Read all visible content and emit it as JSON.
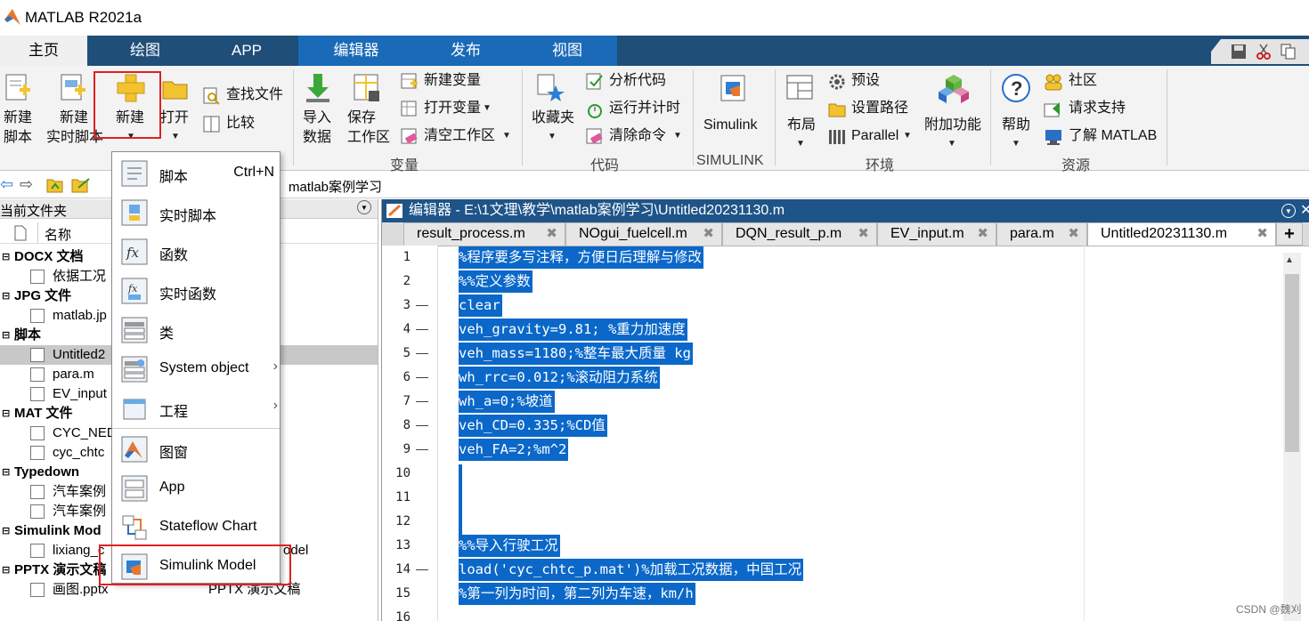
{
  "app": {
    "title": "MATLAB R2021a"
  },
  "main_tabs": [
    "主页",
    "绘图",
    "APP",
    "编辑器",
    "发布",
    "视图"
  ],
  "ribbon": {
    "file": {
      "new_script": [
        "新建",
        "脚本"
      ],
      "new_live": [
        "新建",
        "实时脚本"
      ],
      "new": "新建",
      "open": "打开",
      "find_files": "查找文件",
      "compare": "比较"
    },
    "variable": {
      "import": [
        "导入",
        "数据"
      ],
      "save": [
        "保存",
        "工作区"
      ],
      "new_var": "新建变量",
      "open_var": "打开变量",
      "clear_ws": "清空工作区",
      "label": "变量"
    },
    "code": {
      "favorites": "收藏夹",
      "analyze": "分析代码",
      "run_time": "运行并计时",
      "clear_cmd": "清除命令",
      "label": "代码"
    },
    "simulink": {
      "btn": "Simulink",
      "label": "SIMULINK"
    },
    "environment": {
      "layout": "布局",
      "prefs": "预设",
      "set_path": "设置路径",
      "parallel": "Parallel",
      "addons": "附加功能",
      "label": "环境"
    },
    "resources": {
      "help": "帮助",
      "community": "社区",
      "support": "请求支持",
      "learn": "了解 MATLAB",
      "label": "资源"
    }
  },
  "address": {
    "path": "matlab案例学习"
  },
  "file_panel": {
    "title": "当前文件夹",
    "name_col": "名称",
    "rows": [
      {
        "text": "DOCX 文档",
        "type": "group"
      },
      {
        "text": "依据工况",
        "type": "file"
      },
      {
        "text": "JPG 文件",
        "type": "group"
      },
      {
        "text": "matlab.jp",
        "type": "file"
      },
      {
        "text": "脚本",
        "type": "group"
      },
      {
        "text": "Untitled2",
        "type": "file"
      },
      {
        "text": "para.m",
        "type": "file"
      },
      {
        "text": "EV_input",
        "type": "file"
      },
      {
        "text": "MAT 文件",
        "type": "group"
      },
      {
        "text": "CYC_NED",
        "type": "file"
      },
      {
        "text": "cyc_chtc",
        "type": "file"
      },
      {
        "text": "Typedown",
        "type": "group"
      },
      {
        "text": "汽车案例",
        "type": "file"
      },
      {
        "text": "汽车案例",
        "type": "file"
      },
      {
        "text": "Simulink Mod",
        "type": "group"
      },
      {
        "text": "lixiang_c",
        "type": "file",
        "extra": "odel"
      },
      {
        "text": "PPTX 演示文稿",
        "type": "group"
      },
      {
        "text": "画图.pptx",
        "type": "file",
        "extra": "PPTX 演示文稿"
      }
    ]
  },
  "new_menu": [
    {
      "label": "脚本",
      "shortcut": "Ctrl+N",
      "icon": "script-icon"
    },
    {
      "label": "实时脚本",
      "icon": "live-script-icon"
    },
    {
      "label": "函数",
      "icon": "function-icon"
    },
    {
      "label": "实时函数",
      "icon": "live-function-icon"
    },
    {
      "label": "类",
      "icon": "class-icon"
    },
    {
      "label": "System object",
      "icon": "system-object-icon",
      "submenu": true
    },
    {
      "label": "工程",
      "icon": "project-icon",
      "submenu": true
    },
    {
      "label": "图窗",
      "icon": "figure-icon"
    },
    {
      "label": "App",
      "icon": "app-icon"
    },
    {
      "label": "Stateflow Chart",
      "icon": "stateflow-icon"
    },
    {
      "label": "Simulink Model",
      "icon": "simulink-model-icon"
    }
  ],
  "editor": {
    "title": "编辑器 - E:\\1文理\\教学\\matlab案例学习\\Untitled20231130.m",
    "tabs": [
      "result_process.m",
      "NOgui_fuelcell.m",
      "DQN_result_p.m",
      "EV_input.m",
      "para.m",
      "Untitled20231130.m"
    ],
    "active_tab": 5,
    "lines": [
      {
        "n": "1",
        "dash": "",
        "code": "%程序要多写注释，方便日后理解与修改"
      },
      {
        "n": "2",
        "dash": "",
        "code": "%%定义参数"
      },
      {
        "n": "3",
        "dash": "—",
        "code": "clear"
      },
      {
        "n": "4",
        "dash": "—",
        "code": "veh_gravity=9.81; %重力加速度"
      },
      {
        "n": "5",
        "dash": "—",
        "code": "veh_mass=1180;%整车最大质量 kg"
      },
      {
        "n": "6",
        "dash": "—",
        "code": "wh_rrc=0.012;%滚动阻力系统"
      },
      {
        "n": "7",
        "dash": "—",
        "code": "wh_a=0;%坡道"
      },
      {
        "n": "8",
        "dash": "—",
        "code": "veh_CD=0.335;%CD值"
      },
      {
        "n": "9",
        "dash": "—",
        "code": "veh_FA=2;%m^2"
      },
      {
        "n": "10",
        "dash": "",
        "code": ""
      },
      {
        "n": "11",
        "dash": "",
        "code": ""
      },
      {
        "n": "12",
        "dash": "",
        "code": ""
      },
      {
        "n": "13",
        "dash": "",
        "code": "%%导入行驶工况"
      },
      {
        "n": "14",
        "dash": "—",
        "code": "load('cyc_chtc_p.mat')%加载工况数据，中国工况"
      },
      {
        "n": "15",
        "dash": "",
        "code": "%第一列为时间，第二列为车速，km/h"
      },
      {
        "n": "16",
        "dash": "",
        "code": ""
      }
    ]
  },
  "watermark": "CSDN @魏刈"
}
